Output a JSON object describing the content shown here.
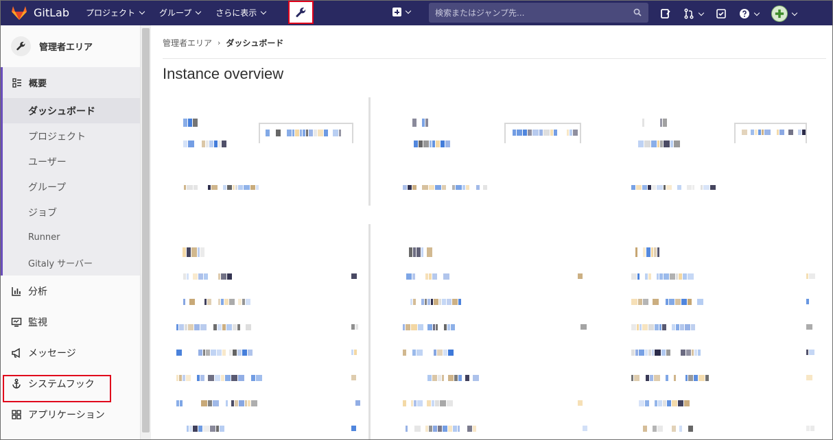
{
  "navbar": {
    "brand": "GitLab",
    "menus": [
      "プロジェクト",
      "グループ",
      "さらに表示"
    ],
    "search_placeholder": "検索またはジャンプ先..."
  },
  "sidebar": {
    "title": "管理者エリア",
    "overview_label": "概要",
    "overview_items": [
      "ダッシュボード",
      "プロジェクト",
      "ユーザー",
      "グループ",
      "ジョブ",
      "Runner",
      "Gitaly サーバー"
    ],
    "items": [
      "分析",
      "監視",
      "メッセージ",
      "システムフック",
      "アプリケーション"
    ]
  },
  "breadcrumb": [
    "管理者エリア",
    "ダッシュボード"
  ],
  "page_title": "Instance overview",
  "colors": {
    "navbar": "#292961",
    "accent": "#6b4fbb",
    "highlight": "#e0001b"
  }
}
